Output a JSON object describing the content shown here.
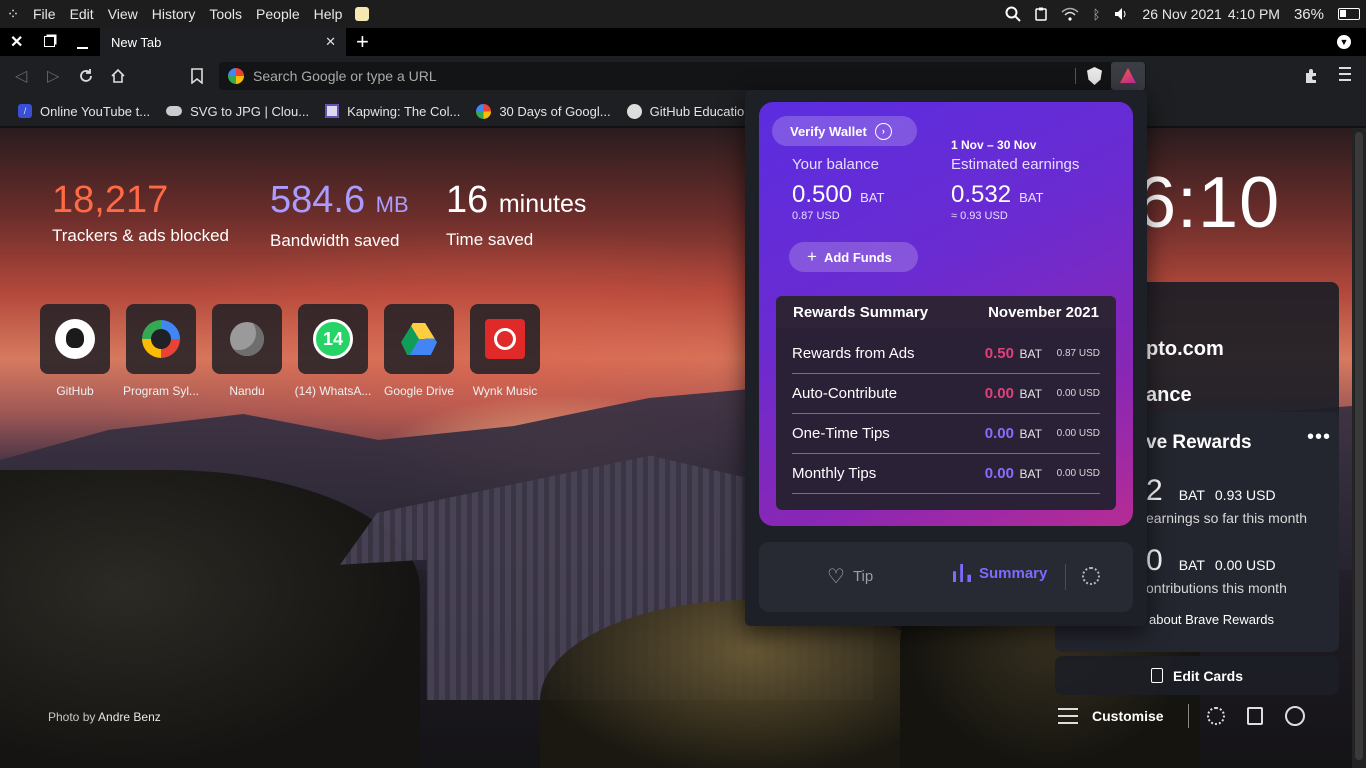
{
  "system": {
    "menu": [
      "File",
      "Edit",
      "View",
      "History",
      "Tools",
      "People",
      "Help"
    ],
    "datetime": "26 Nov 2021 / 4:10 PM",
    "battery": "36%"
  },
  "tab": {
    "title": "New Tab"
  },
  "omnibox": {
    "placeholder": "Search Google or type a URL"
  },
  "bookmarks": [
    {
      "label": "Online YouTube t...",
      "icon": "youtube-converter-icon"
    },
    {
      "label": "SVG to JPG | Clou...",
      "icon": "cloudconvert-icon"
    },
    {
      "label": "Kapwing: The Col...",
      "icon": "kapwing-icon"
    },
    {
      "label": "30 Days of Googl...",
      "icon": "google-icon"
    },
    {
      "label": "GitHub Educatio",
      "icon": "github-icon"
    }
  ],
  "stats": {
    "trackers": {
      "value": "18,217",
      "label": "Trackers & ads blocked"
    },
    "bandwidth": {
      "value": "584.6",
      "unit": "MB",
      "label": "Bandwidth saved"
    },
    "time": {
      "value": "16",
      "unit": "minutes",
      "label": "Time saved"
    }
  },
  "top_sites": [
    {
      "label": "GitHub"
    },
    {
      "label": "Program Syl..."
    },
    {
      "label": "Nandu"
    },
    {
      "label": "(14) WhatsA...",
      "badge": "14"
    },
    {
      "label": "Google Drive"
    },
    {
      "label": "Wynk Music"
    }
  ],
  "photo_credit": {
    "prefix": "Photo by",
    "author": "Andre Benz"
  },
  "clock": "6:10",
  "widget": {
    "crypto": "pto.com",
    "binance": "ance",
    "rewards_title": "ve Rewards",
    "earnings": {
      "value": "2",
      "unit": "BAT",
      "usd": "0.93 USD",
      "label": "earnings so far this month"
    },
    "contributions": {
      "value": "0",
      "unit": "BAT",
      "usd": "0.00 USD",
      "label": "ontributions this month"
    },
    "about": "about Brave Rewards",
    "edit_cards": "Edit Cards",
    "customise": "Customise"
  },
  "rewards": {
    "verify_wallet": "Verify Wallet",
    "balance_label": "Your balance",
    "balance": "0.500",
    "balance_unit": "BAT",
    "balance_usd": "0.87 USD",
    "period": "1 Nov – 30 Nov",
    "earnings_label": "Estimated earnings",
    "earnings": "0.532",
    "earnings_unit": "BAT",
    "earnings_usd": "≈  0.93 USD",
    "add_funds": "Add Funds",
    "summary_title": "Rewards Summary",
    "summary_month": "November 2021",
    "rows": [
      {
        "label": "Rewards from Ads",
        "value": "0.50",
        "unit": "BAT",
        "usd": "0.87 USD",
        "color": "#e0407a"
      },
      {
        "label": "Auto-Contribute",
        "value": "0.00",
        "unit": "BAT",
        "usd": "0.00 USD",
        "color": "#e0407a"
      },
      {
        "label": "One-Time Tips",
        "value": "0.00",
        "unit": "BAT",
        "usd": "0.00 USD",
        "color": "#8b6bff"
      },
      {
        "label": "Monthly Tips",
        "value": "0.00",
        "unit": "BAT",
        "usd": "0.00 USD",
        "color": "#8b6bff"
      }
    ],
    "tip": "Tip",
    "summary": "Summary"
  },
  "colors": {
    "accent": "#6f4cff",
    "orange": "#ff6a45",
    "lavender": "#a99bff"
  }
}
